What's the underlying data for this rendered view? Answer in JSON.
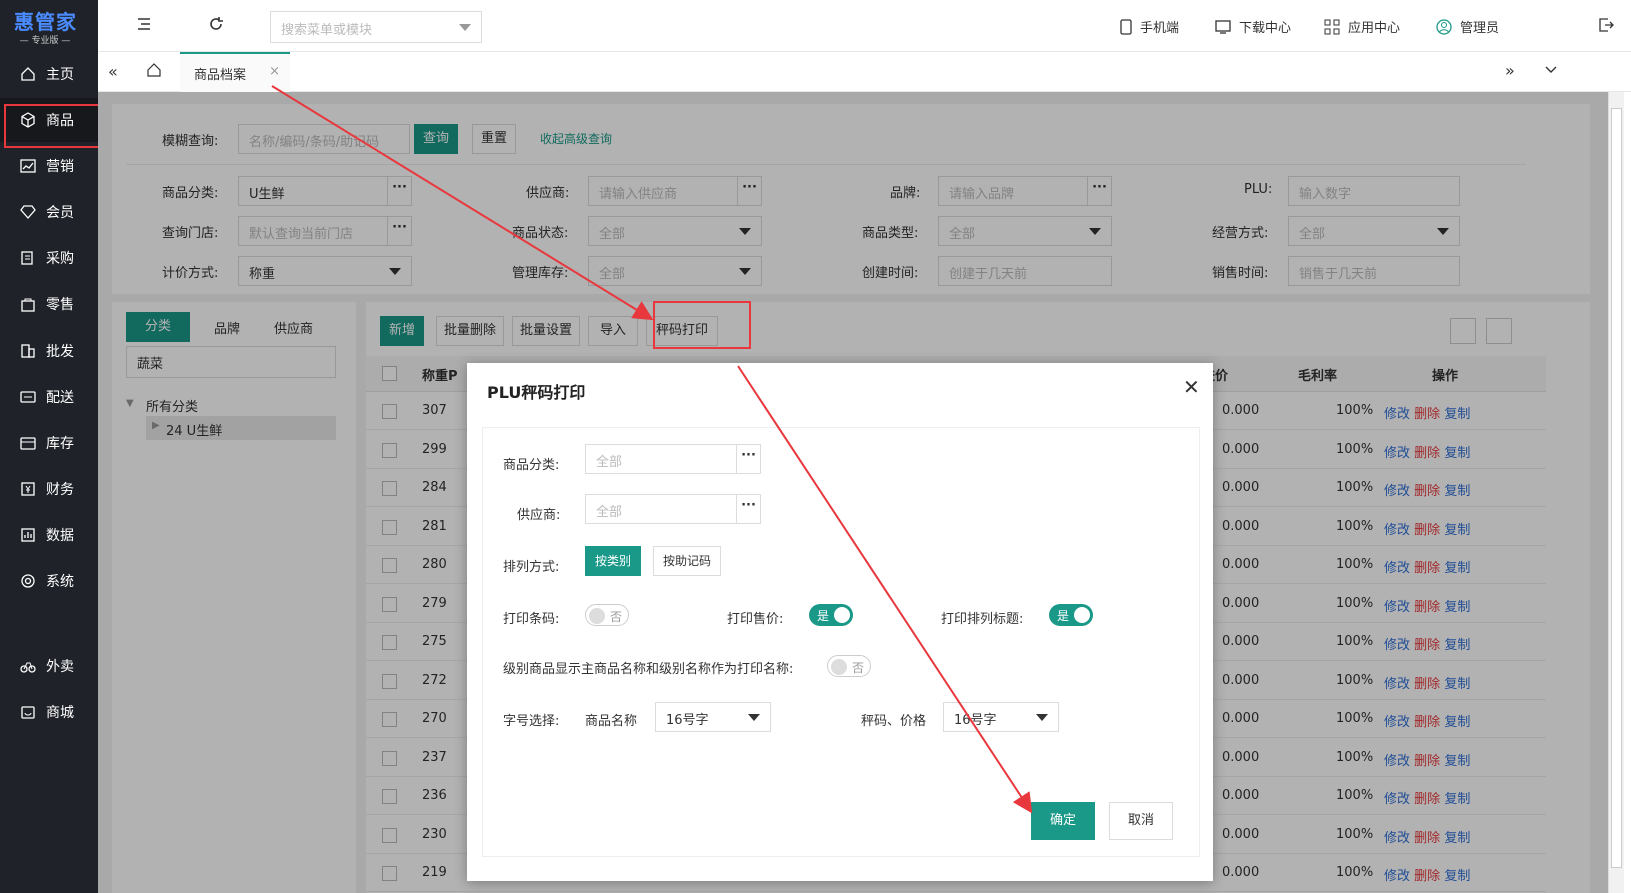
{
  "app": {
    "brand": "惠管家",
    "edition": "— 专业版 —"
  },
  "sidebar": {
    "items": [
      {
        "label": "主页",
        "icon": "home-icon"
      },
      {
        "label": "商品",
        "icon": "cube-icon"
      },
      {
        "label": "营销",
        "icon": "chart-icon"
      },
      {
        "label": "会员",
        "icon": "diamond-icon"
      },
      {
        "label": "采购",
        "icon": "purchase-icon"
      },
      {
        "label": "零售",
        "icon": "bag-icon"
      },
      {
        "label": "批发",
        "icon": "building-icon"
      },
      {
        "label": "配送",
        "icon": "truck-icon"
      },
      {
        "label": "库存",
        "icon": "box-icon"
      },
      {
        "label": "财务",
        "icon": "finance-icon"
      },
      {
        "label": "数据",
        "icon": "data-icon"
      },
      {
        "label": "系统",
        "icon": "gear-icon"
      },
      {
        "label": "外卖",
        "icon": "bike-icon"
      },
      {
        "label": "商城",
        "icon": "store-icon"
      }
    ]
  },
  "header": {
    "search_placeholder": "搜索菜单或模块",
    "mobile": "手机端",
    "download": "下载中心",
    "apps": "应用中心",
    "user": "管理员"
  },
  "tabs": {
    "active": "商品档案",
    "close": "×"
  },
  "filters": {
    "fuzzy_label": "模糊查询:",
    "fuzzy_placeholder": "名称/编码/条码/助记码",
    "query_btn": "查询",
    "reset_btn": "重置",
    "collapse_link": "收起高级查询",
    "category_label": "商品分类:",
    "category_value": "U生鲜",
    "supplier_label": "供应商:",
    "supplier_placeholder": "请输入供应商",
    "brand_label": "品牌:",
    "brand_placeholder": "请输入品牌",
    "plu_label": "PLU:",
    "plu_placeholder": "输入数字",
    "store_label": "查询门店:",
    "store_placeholder": "默认查询当前门店",
    "status_label": "商品状态:",
    "status_value": "全部",
    "type_label": "商品类型:",
    "type_value": "全部",
    "mode_label": "经营方式:",
    "mode_value": "全部",
    "pricing_label": "计价方式:",
    "pricing_value": "称重",
    "stock_label": "管理库存:",
    "stock_value": "全部",
    "created_label": "创建时间:",
    "created_placeholder": "创建于几天前",
    "sold_label": "销售时间:",
    "sold_placeholder": "销售于几天前"
  },
  "tree": {
    "tabs": [
      "分类",
      "品牌",
      "供应商"
    ],
    "search_value": "蔬菜",
    "root": "所有分类",
    "child": "24 U生鲜"
  },
  "toolbar": {
    "add": "新增",
    "batch_delete": "批量删除",
    "batch_set": "批量设置",
    "import": "导入",
    "plu_print": "秤码打印"
  },
  "table": {
    "col_code": "称重P",
    "col_cost": "进价",
    "col_margin": "毛利率",
    "col_ops": "操作",
    "op_edit": "修改",
    "op_delete": "删除",
    "op_copy": "复制",
    "rows": [
      {
        "code": "307",
        "cost": "0.000",
        "margin": "100%"
      },
      {
        "code": "299",
        "cost": "0.000",
        "margin": "100%"
      },
      {
        "code": "284",
        "cost": "0.000",
        "margin": "100%"
      },
      {
        "code": "281",
        "cost": "0.000",
        "margin": "100%"
      },
      {
        "code": "280",
        "cost": "0.000",
        "margin": "100%"
      },
      {
        "code": "279",
        "cost": "0.000",
        "margin": "100%"
      },
      {
        "code": "275",
        "cost": "0.000",
        "margin": "100%"
      },
      {
        "code": "272",
        "cost": "0.000",
        "margin": "100%"
      },
      {
        "code": "270",
        "cost": "0.000",
        "margin": "100%"
      },
      {
        "code": "237",
        "cost": "0.000",
        "margin": "100%"
      },
      {
        "code": "236",
        "cost": "0.000",
        "margin": "100%"
      },
      {
        "code": "230",
        "cost": "0.000",
        "margin": "100%"
      },
      {
        "code": "219",
        "cost": "0.000",
        "margin": "100%"
      }
    ]
  },
  "dialog": {
    "title": "PLU秤码打印",
    "category_label": "商品分类:",
    "category_placeholder": "全部",
    "supplier_label": "供应商:",
    "supplier_placeholder": "全部",
    "sort_label": "排列方式:",
    "sort_by_category": "按类别",
    "sort_by_mnemonic": "按助记码",
    "print_barcode_label": "打印条码:",
    "print_price_label": "打印售价:",
    "print_title_label": "打印排列标题:",
    "level_label": "级别商品显示主商品名称和级别名称作为打印名称:",
    "toggle_yes": "是",
    "toggle_no": "否",
    "font_label": "字号选择:",
    "name_label": "商品名称",
    "name_font": "16号字",
    "code_price_label": "秤码、价格",
    "code_price_font": "16号字",
    "confirm": "确定",
    "cancel": "取消"
  },
  "colors": {
    "accent": "#1a9988",
    "sidebar_bg": "#1f2329",
    "highlight": "#e8383d"
  }
}
